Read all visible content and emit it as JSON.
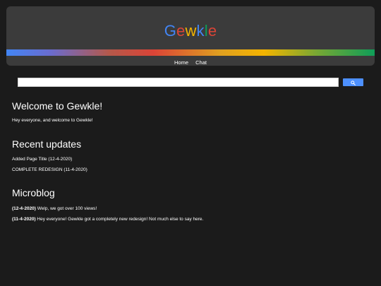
{
  "header": {
    "logo_letters": [
      {
        "char": "G",
        "color": "#4285f4"
      },
      {
        "char": "e",
        "color": "#db4437"
      },
      {
        "char": "w",
        "color": "#f4b400"
      },
      {
        "char": "k",
        "color": "#4285f4"
      },
      {
        "char": "l",
        "color": "#0f9d58"
      },
      {
        "char": "e",
        "color": "#db4437"
      }
    ],
    "nav": [
      {
        "label": "Home"
      },
      {
        "label": "Chat"
      }
    ]
  },
  "search": {
    "value": "",
    "button_icon": "search-icon",
    "button_color": "#4d90fe"
  },
  "welcome": {
    "title": "Welcome to Gewkle!",
    "text": "Hey everyone, and welcome to Gewkle!"
  },
  "updates": {
    "title": "Recent updates",
    "items": [
      "Added Page Title (12-4-2020)",
      "COMPLETE REDESIGN (11-4-2020)"
    ]
  },
  "microblog": {
    "title": "Microblog",
    "posts": [
      {
        "date": "(12-4-2020)",
        "text": " Welp, we got over 100 views!"
      },
      {
        "date": "(11-4-2020)",
        "text": " Hey everyone! Gewkle got a completely new redesign! Not much else to say here."
      }
    ]
  }
}
